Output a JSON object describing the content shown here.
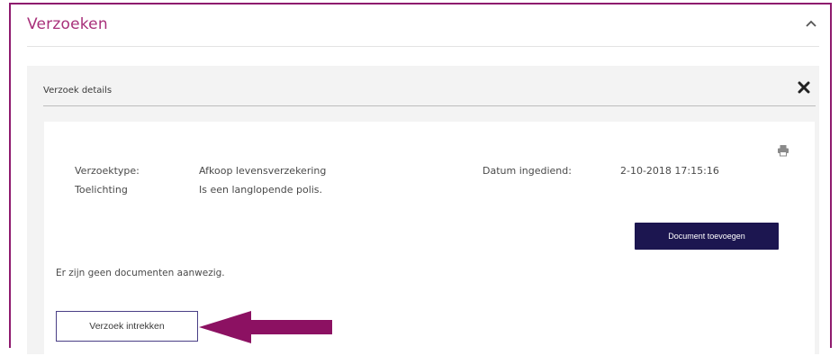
{
  "section": {
    "title": "Verzoeken",
    "collapse_icon": "chevron-up-icon"
  },
  "details": {
    "title": "Verzoek details",
    "close_icon": "close-icon",
    "print_icon": "printer-icon",
    "fields": {
      "type_label": "Verzoektype:",
      "type_value": "Afkoop levensverzekering",
      "note_label": "Toelichting",
      "note_value": "Is een langlopende polis.",
      "date_label": "Datum ingediend:",
      "date_value": "2-10-2018 17:15:16"
    },
    "add_document_label": "Document toevoegen",
    "no_documents_text": "Er zijn geen documenten aanwezig.",
    "withdraw_label": "Verzoek intrekken"
  },
  "colors": {
    "frame_border": "#8e1a6e",
    "title_magenta": "#a8307a",
    "primary_button": "#1c1650",
    "arrow": "#8c1162"
  }
}
